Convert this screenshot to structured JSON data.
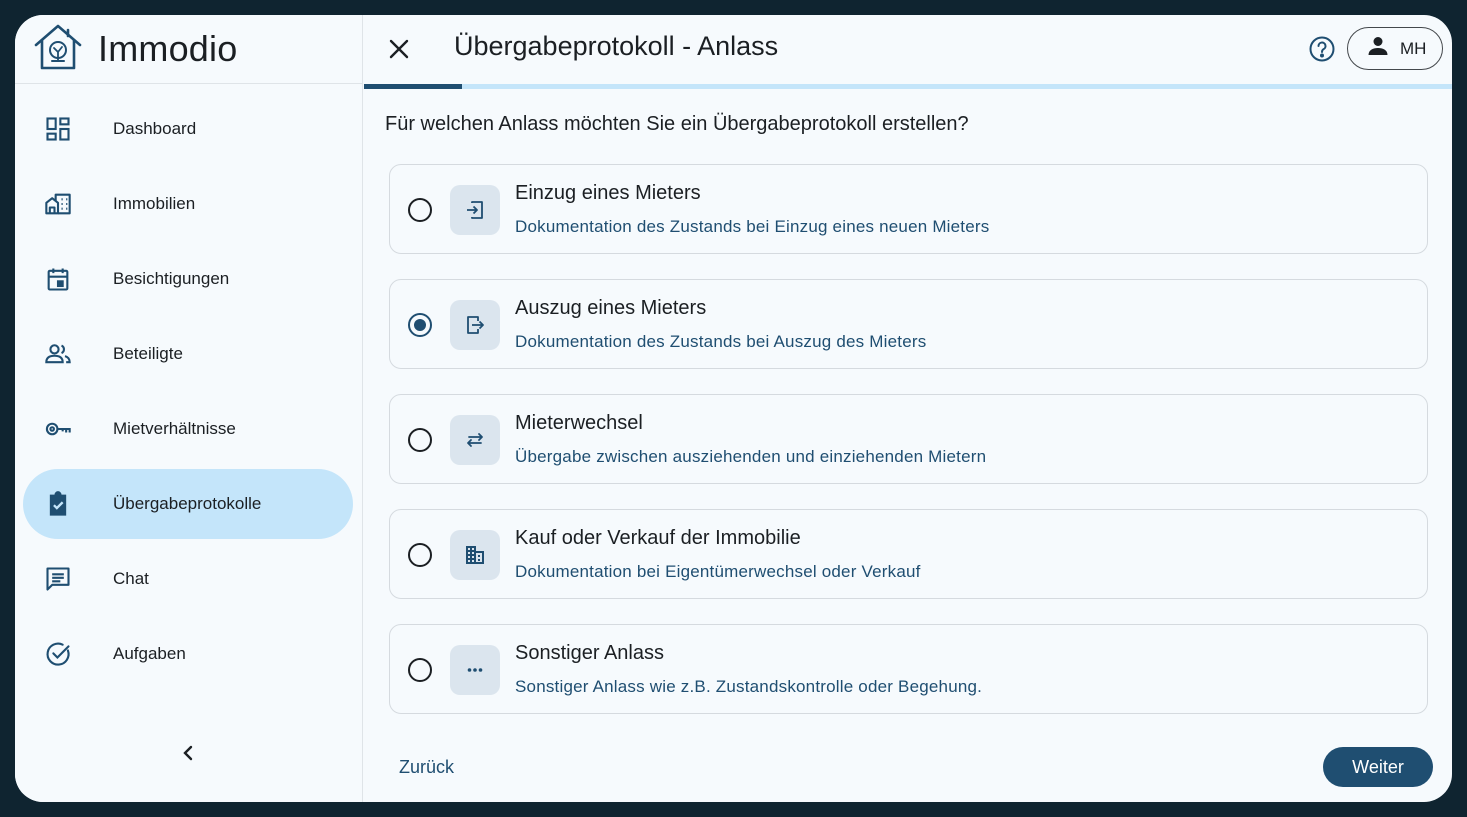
{
  "app": {
    "name": "Immodio"
  },
  "colors": {
    "primary": "#1f4e71",
    "active_nav": "#c4e5fa",
    "background": "#f6fafd",
    "outer_frame": "#0f2430"
  },
  "sidebar": {
    "items": [
      {
        "label": "Dashboard",
        "icon": "dashboard-icon",
        "active": false
      },
      {
        "label": "Immobilien",
        "icon": "buildings-icon",
        "active": false
      },
      {
        "label": "Besichtigungen",
        "icon": "calendar-icon",
        "active": false
      },
      {
        "label": "Beteiligte",
        "icon": "people-icon",
        "active": false
      },
      {
        "label": "Mietverhältnisse",
        "icon": "key-icon",
        "active": false
      },
      {
        "label": "Übergabeprotokolle",
        "icon": "clipboard-check-icon",
        "active": true
      },
      {
        "label": "Chat",
        "icon": "chat-icon",
        "active": false
      },
      {
        "label": "Aufgaben",
        "icon": "check-circle-icon",
        "active": false
      }
    ],
    "collapse_icon": "chevron-left-icon"
  },
  "header": {
    "title": "Übergabeprotokoll - Anlass",
    "close_icon": "close-icon",
    "help_icon": "help-icon",
    "user_initials": "MH",
    "progress_fraction": 0.09
  },
  "main": {
    "question": "Für welchen Anlass möchten Sie ein Übergabeprotokoll erstellen?",
    "options": [
      {
        "title": "Einzug eines Mieters",
        "description": "Dokumentation des Zustands bei Einzug eines neuen Mieters",
        "icon": "login-icon",
        "selected": false
      },
      {
        "title": "Auszug eines Mieters",
        "description": "Dokumentation des Zustands bei Auszug des Mieters",
        "icon": "logout-icon",
        "selected": true
      },
      {
        "title": "Mieterwechsel",
        "description": "Übergabe zwischen ausziehenden und einziehenden Mietern",
        "icon": "swap-icon",
        "selected": false
      },
      {
        "title": "Kauf oder Verkauf der Immobilie",
        "description": "Dokumentation bei Eigentümerwechsel oder Verkauf",
        "icon": "building-icon",
        "selected": false
      },
      {
        "title": "Sonstiger Anlass",
        "description": "Sonstiger Anlass wie z.B. Zustandskontrolle oder Begehung.",
        "icon": "more-icon",
        "selected": false
      }
    ],
    "back_label": "Zurück",
    "next_label": "Weiter"
  }
}
